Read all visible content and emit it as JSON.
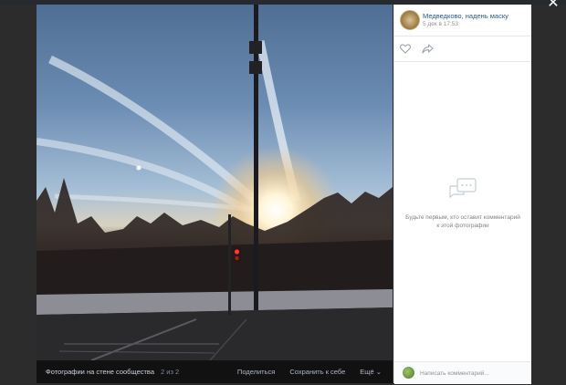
{
  "viewer": {
    "close_label": "✕"
  },
  "photo_bar": {
    "album_label": "Фотографии на стене сообщества",
    "counter": "2 из 2",
    "share_label": "Поделиться",
    "save_label": "Сохранить к себе",
    "more_label": "Ещё ⌄"
  },
  "panel": {
    "author_name": "Медведково, надень маску",
    "date": "5 дек в 17:53",
    "empty_text": "Будьте первым, кто оставит комментарий к этой фотографии",
    "comment_placeholder": "Написать комментарий..."
  },
  "icons": {
    "like": "heart-icon",
    "share": "share-arrow-icon",
    "empty": "comments-icon"
  },
  "colors": {
    "link": "#2a5885",
    "muted": "#828282",
    "photo_bar": "#111111"
  }
}
